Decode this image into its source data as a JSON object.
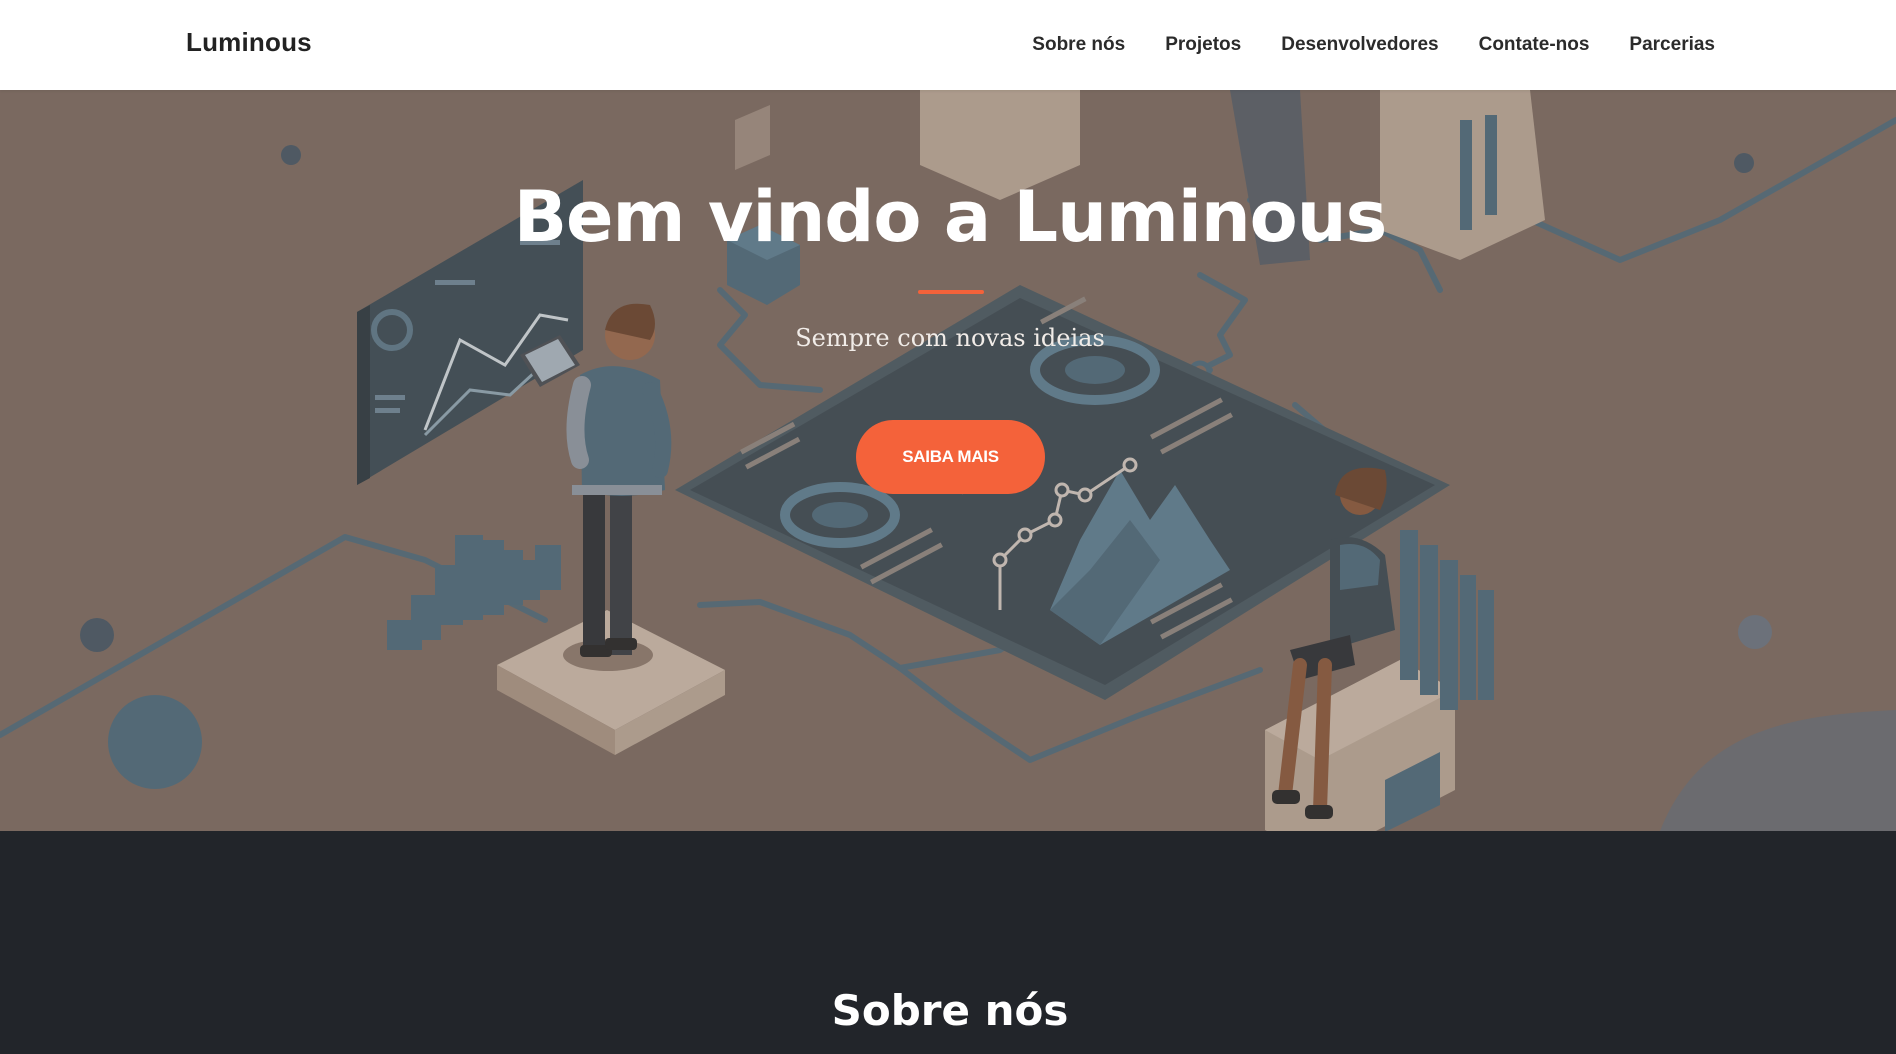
{
  "navbar": {
    "brand": "Luminous",
    "links": [
      "Sobre nós",
      "Projetos",
      "Desenvolvedores",
      "Contate-nos",
      "Parcerias"
    ]
  },
  "hero": {
    "title": "Bem vindo a Luminous",
    "subtitle": "Sempre com novas ideias",
    "cta_label": "SAIBA MAIS",
    "illustration": "isometric-data-dashboard-illustration"
  },
  "about": {
    "title": "Sobre nós"
  },
  "colors": {
    "accent": "#f4623a",
    "hero_bg": "#7d6c62",
    "dark_section": "#22252a",
    "navbar_bg": "#ffffff",
    "illustration_blue": "#4f6b7c"
  }
}
